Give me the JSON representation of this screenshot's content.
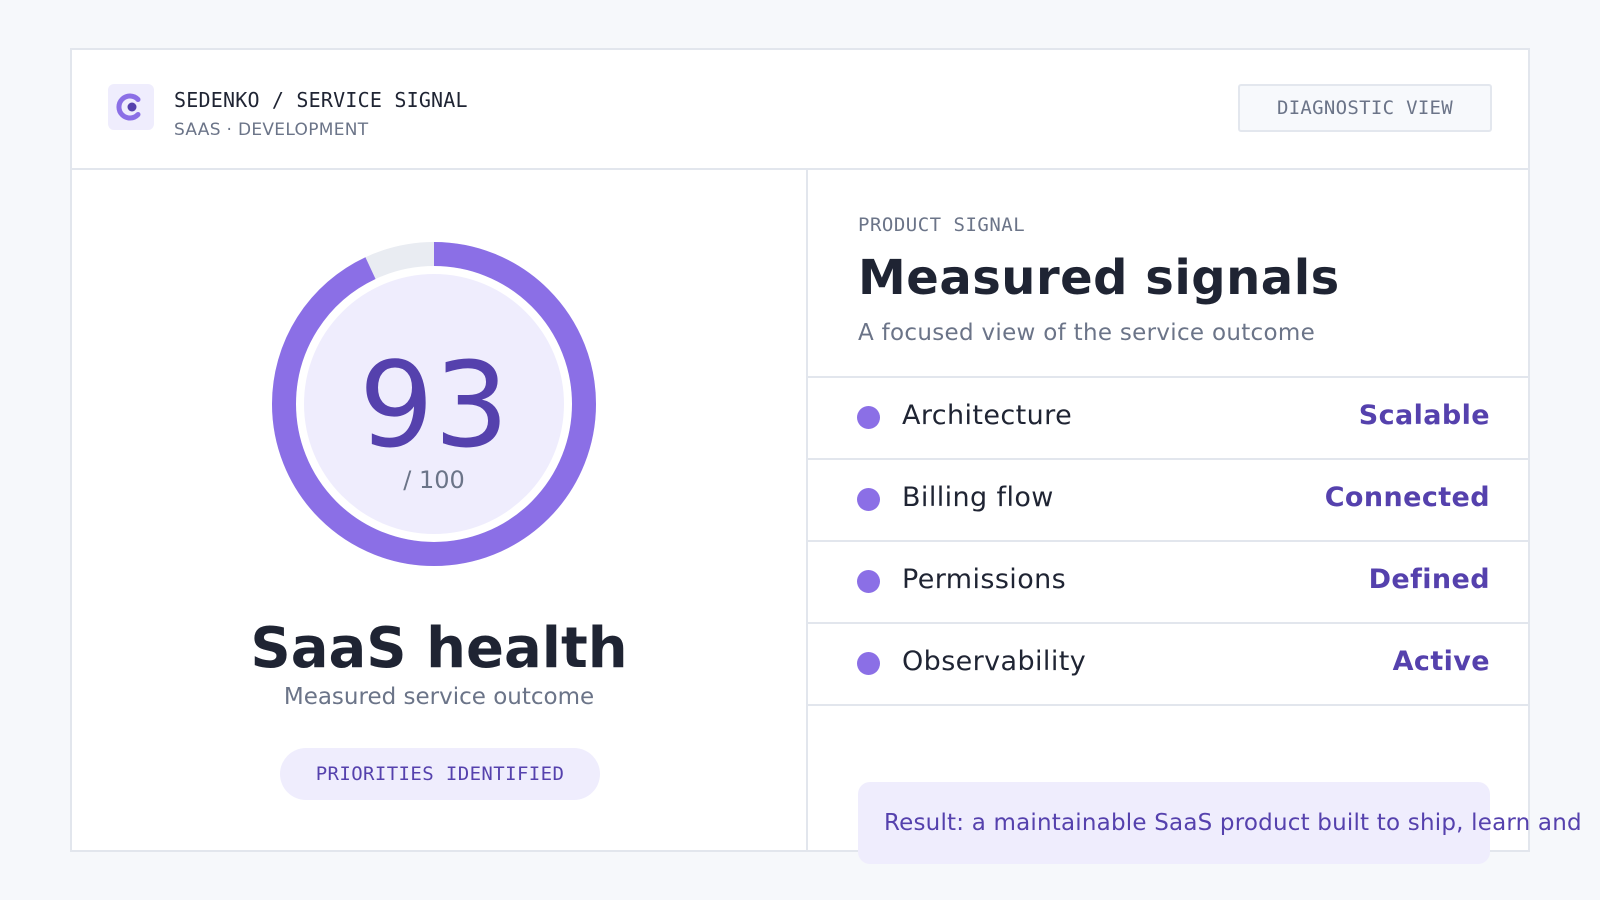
{
  "header": {
    "title": "SEDENKO / SERVICE SIGNAL",
    "subtitle": "SAAS · DEVELOPMENT",
    "view_button": "DIAGNOSTIC VIEW",
    "logo_icon": "brand-c-icon"
  },
  "score": {
    "value": "93",
    "max_label": "/ 100",
    "fraction": 0.93,
    "title": "SaaS health",
    "subtitle": "Measured service outcome",
    "badge": "PRIORITIES IDENTIFIED"
  },
  "panel": {
    "eyebrow": "PRODUCT SIGNAL",
    "title": "Measured signals",
    "subtitle": "A focused view of the service outcome",
    "signals": [
      {
        "label": "Architecture",
        "value": "Scalable"
      },
      {
        "label": "Billing flow",
        "value": "Connected"
      },
      {
        "label": "Permissions",
        "value": "Defined"
      },
      {
        "label": "Observability",
        "value": "Active"
      }
    ],
    "result": "Result: a maintainable SaaS product built to ship, learn and"
  },
  "colors": {
    "accent": "#8b6fe6",
    "accent_dark": "#5541ad",
    "accent_soft": "#efedfd",
    "track": "#e9ecf2",
    "text": "#1f2433",
    "muted": "#6b7488",
    "background": "#f6f8fb"
  }
}
